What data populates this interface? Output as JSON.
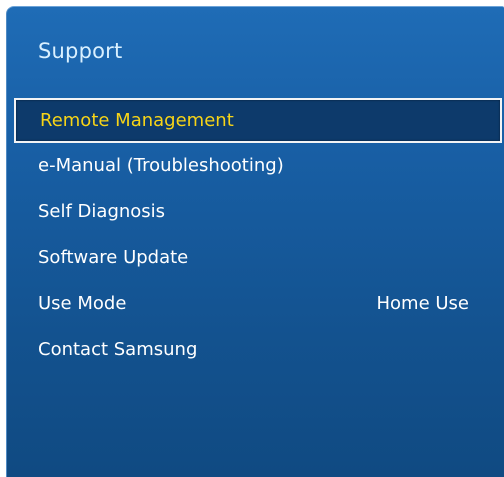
{
  "menu": {
    "title": "Support",
    "items": [
      {
        "label": "Remote Management",
        "selected": true
      },
      {
        "label": "e-Manual (Troubleshooting)"
      },
      {
        "label": "Self Diagnosis"
      },
      {
        "label": "Software Update"
      },
      {
        "label": "Use Mode",
        "value": "Home Use"
      },
      {
        "label": "Contact Samsung"
      }
    ]
  },
  "colors": {
    "panel_blue": "#185fa5",
    "selected_background": "#0d3a6b",
    "selected_text": "#f7d417",
    "title_text": "#d9f0ff",
    "item_text": "#ffffff"
  }
}
